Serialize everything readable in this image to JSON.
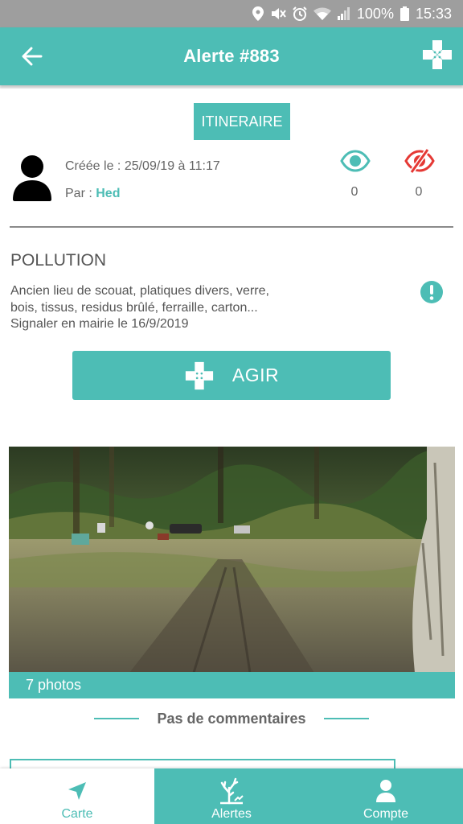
{
  "status_bar": {
    "battery_percent": "100%",
    "time": "15:33"
  },
  "header": {
    "title": "Alerte #883",
    "back_icon": "arrow-left-icon",
    "action_icon": "bandage-plus-icon"
  },
  "itinerary_button": "ITINERAIRE",
  "alert": {
    "created_label": "Créée le : 25/09/19 à 11:17",
    "author_prefix": "Par : ",
    "author_name": "Hed",
    "seen_count": "0",
    "unseen_count": "0",
    "category": "POLLUTION",
    "description_lines": [
      "Ancien lieu de scouat, platiques divers, verre,",
      "bois, tissus, residus brûlé, ferraille, carton...",
      "Signaler en mairie le 16/9/2019"
    ]
  },
  "act_button": "AGIR",
  "photos": {
    "count_label": "7 photos"
  },
  "comments": {
    "empty_label": "Pas de  commentaires"
  },
  "bottom_nav": {
    "items": [
      {
        "label": "Carte",
        "icon": "navigation-arrow-icon",
        "active": true
      },
      {
        "label": "Alertes",
        "icon": "tree-alert-icon",
        "active": false
      },
      {
        "label": "Compte",
        "icon": "user-icon",
        "active": false
      }
    ]
  },
  "colors": {
    "accent": "#4dbdb5",
    "status_bar": "#9e9e9e",
    "eye_seen": "#4dbdb5",
    "eye_unseen": "#e53935",
    "text": "#666666"
  }
}
